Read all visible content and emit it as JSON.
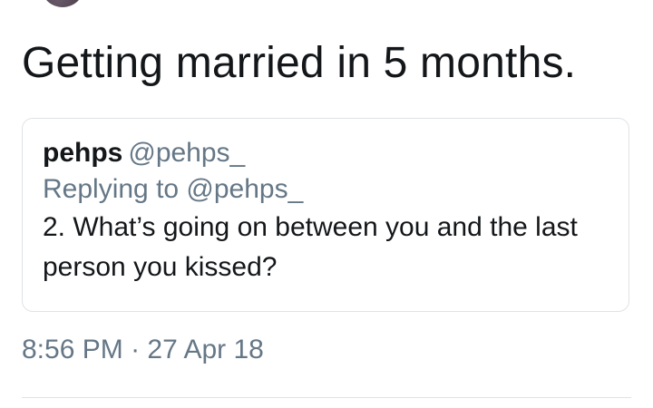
{
  "tweet": {
    "text": "Getting married in 5 months."
  },
  "quoted_tweet": {
    "name": "pehps",
    "handle": "@pehps_",
    "replying_to": "Replying to @pehps_",
    "body": "2. What’s going on between you and the last person you kissed?"
  },
  "meta": {
    "time": "8:56 PM",
    "separator": "·",
    "date": "27 Apr 18"
  }
}
